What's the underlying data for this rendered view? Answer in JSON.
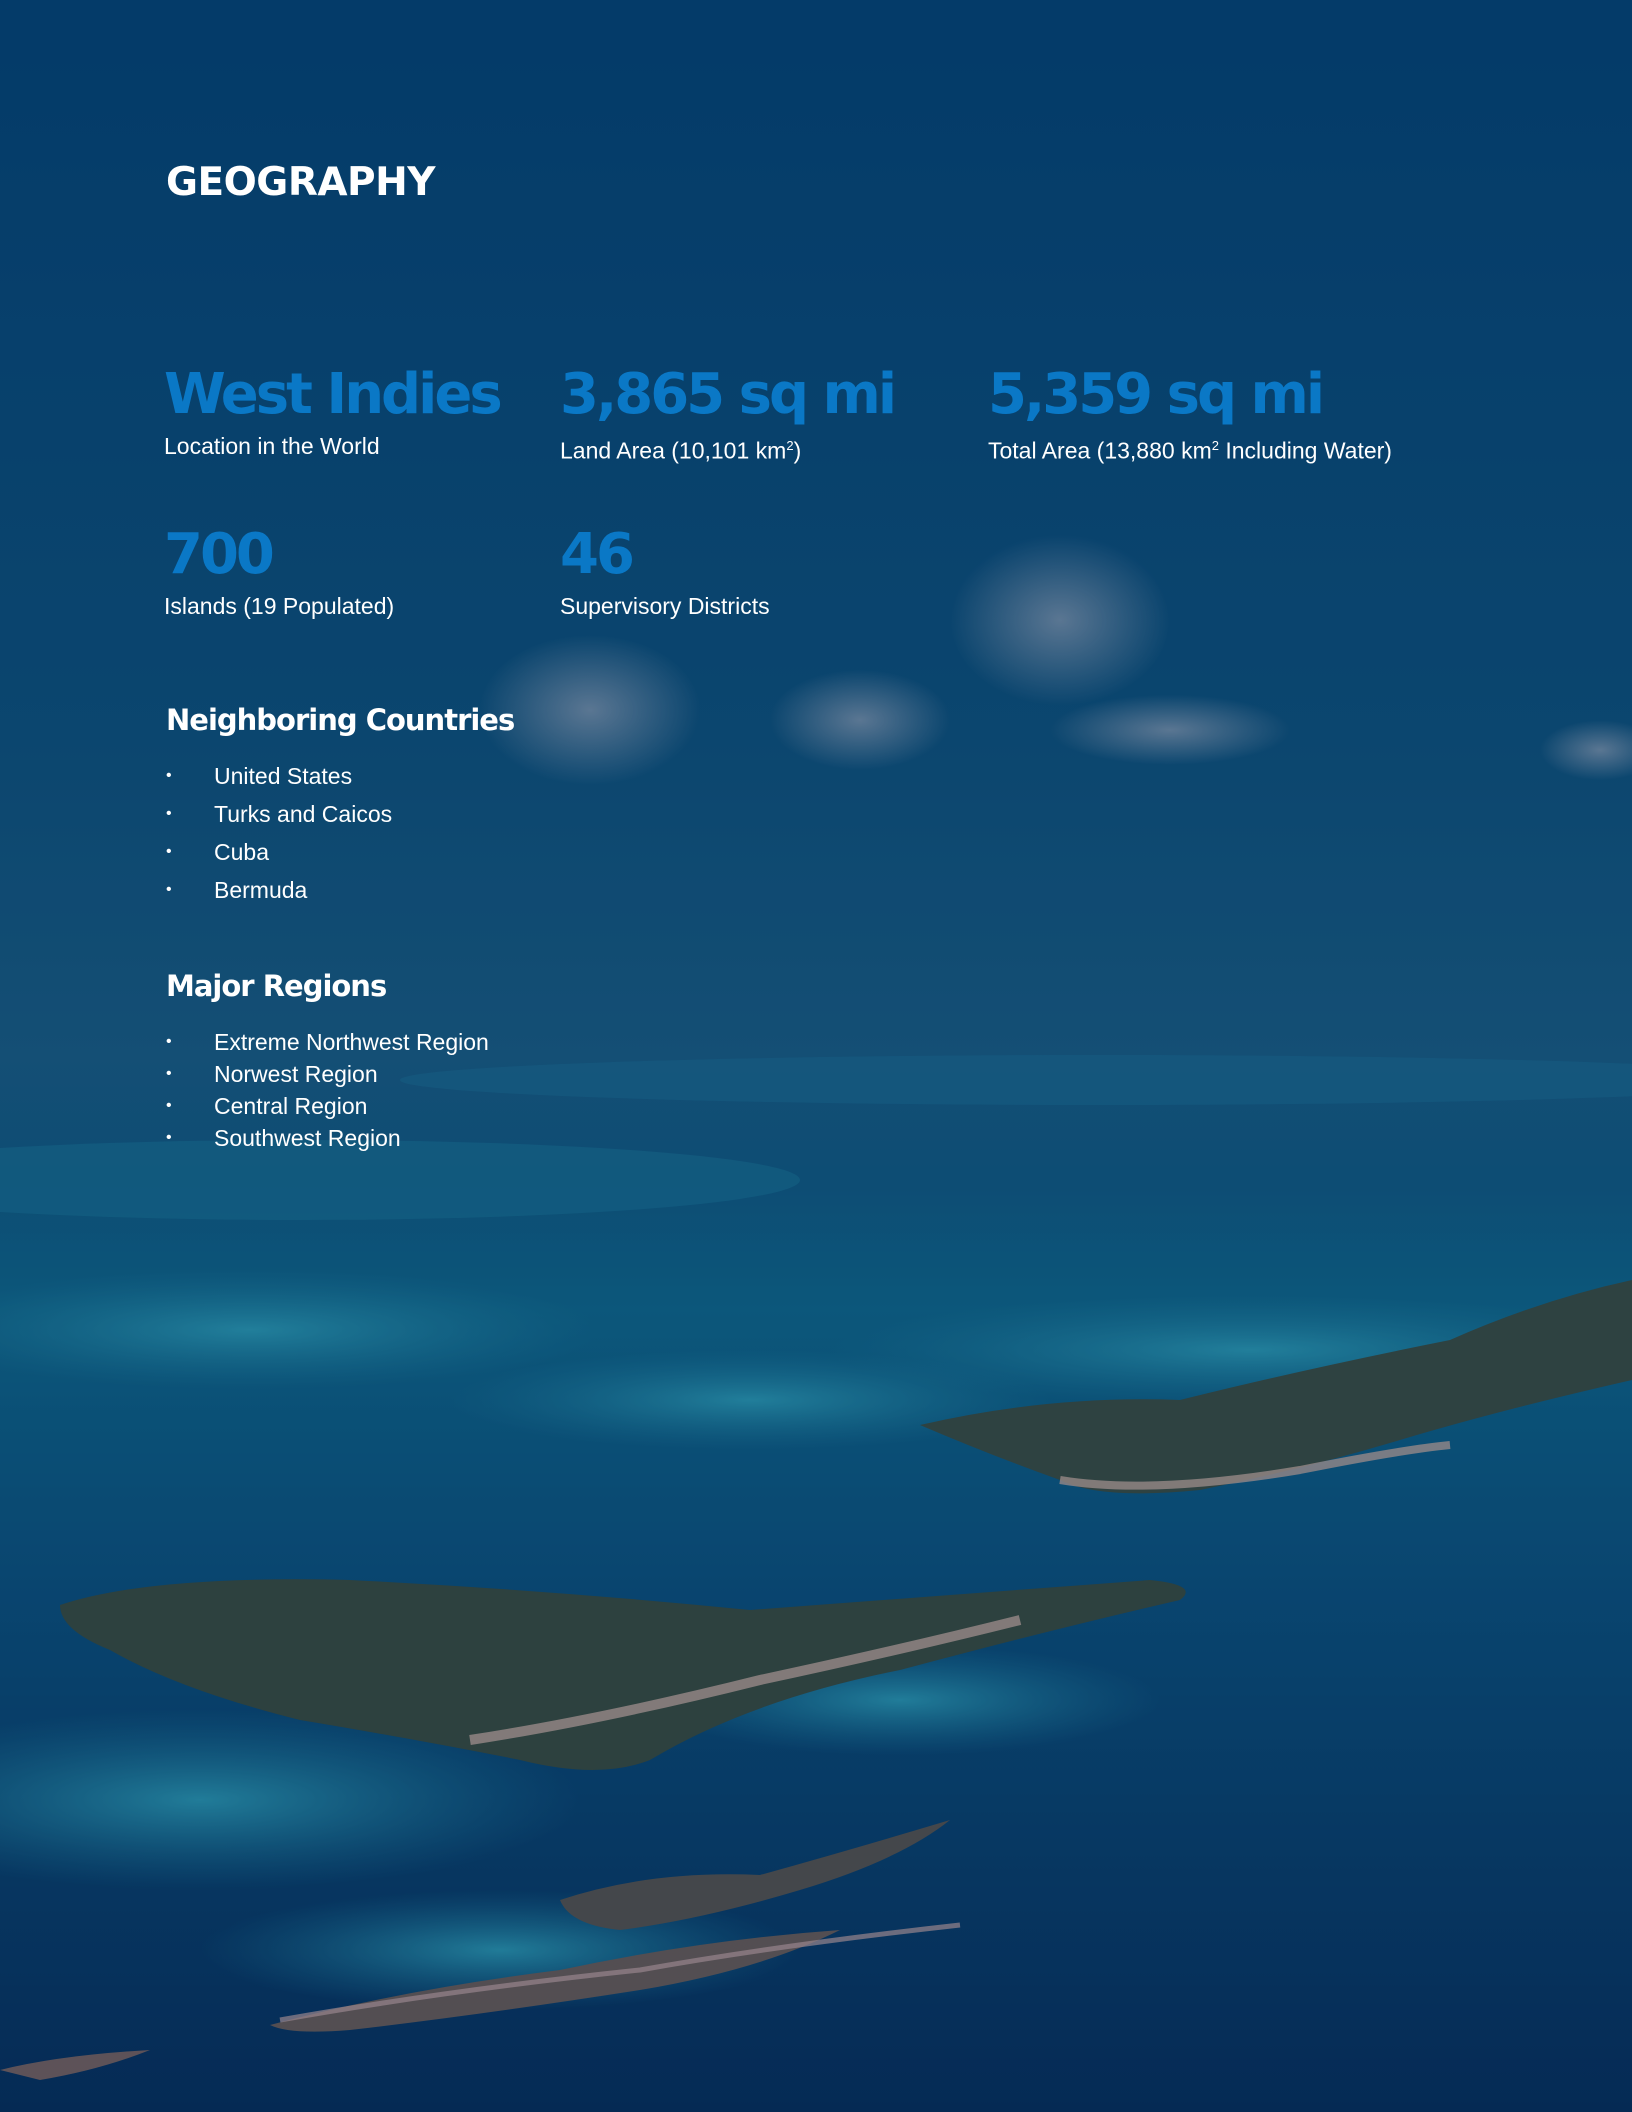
{
  "page": {
    "title": "GEOGRAPHY"
  },
  "stats": [
    {
      "value": "West Indies",
      "label": "Location in the World"
    },
    {
      "value": "3,865 sq mi",
      "label_prefix": "Land Area (10,101 km",
      "label_sup": "2",
      "label_suffix": ")"
    },
    {
      "value": "5,359 sq mi",
      "label_prefix": "Total Area (13,880 km",
      "label_sup": "2",
      "label_suffix": " Including Water)"
    },
    {
      "value": "700",
      "label": "Islands (19 Populated)"
    },
    {
      "value": "46",
      "label": "Supervisory Districts"
    }
  ],
  "neighboring": {
    "heading": "Neighboring Countries",
    "items": [
      "United States",
      "Turks and Caicos",
      "Cuba",
      "Bermuda"
    ]
  },
  "regions": {
    "heading": "Major Regions",
    "items": [
      "Extreme Northwest Region",
      "Norwest Region",
      "Central Region",
      "Southwest Region"
    ]
  },
  "bullet_glyph": "•",
  "colors": {
    "accent_blue": "#0a78c6",
    "text": "#ffffff",
    "sky_top": "#04406b",
    "sea_deep": "#062a52",
    "shallow_turquoise": "#1e8aa6",
    "island_green": "#3b4a3a",
    "sand": "#c9a99a"
  },
  "background_image": {
    "subject": "aerial-view-of-islands-and-shallow-sea"
  }
}
